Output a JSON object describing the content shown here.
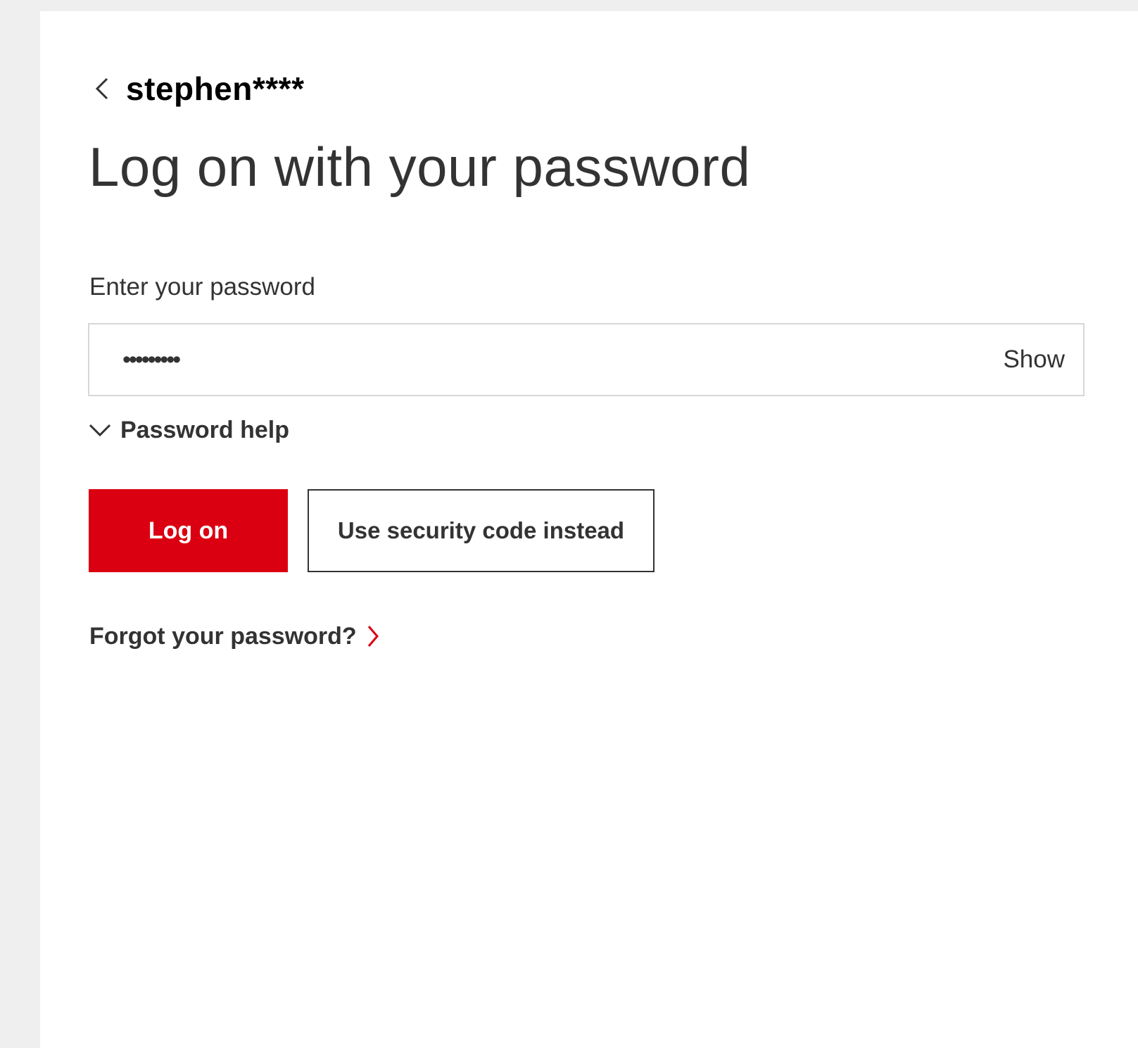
{
  "header": {
    "username": "stephen****",
    "back_icon": "chevron-left-icon"
  },
  "title": "Log on with your password",
  "password_field": {
    "label": "Enter your password",
    "masked_value": "•••••••••",
    "show_label": "Show"
  },
  "password_help": {
    "label": "Password help",
    "icon": "chevron-down-icon"
  },
  "actions": {
    "log_on_label": "Log on",
    "security_code_label": "Use security code instead"
  },
  "forgot": {
    "label": "Forgot your password?",
    "icon": "chevron-right-icon"
  },
  "colors": {
    "brand_red": "#db0011",
    "text": "#333333",
    "page_background": "#efefef",
    "panel_background": "#ffffff",
    "field_border": "#d7d7d7"
  }
}
